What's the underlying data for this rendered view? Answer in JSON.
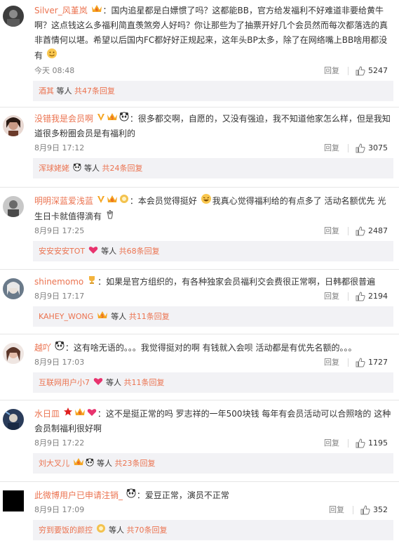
{
  "comments": [
    {
      "username": "Silver_风堇岚",
      "text": "：国内追星都是白嫖惯了吗？这都能BB，官方给发福利不好难道非要给黄牛啊？这点钱这么多福利简直羡煞旁人好吗？你让那些为了抽票开好几个会员然而每次都落选的真非酋情何以堪。希望以后国内FC都好好正规起来，这年头BP太多，除了在网络嘴上BB啥用都没有",
      "time": "今天 08:48",
      "reply_label": "回复",
      "likes": "5247",
      "reply_user": "酒其",
      "reply_mid": " 等人 ",
      "reply_count": "共47条回复"
    },
    {
      "username": "没错我是会员啊",
      "text": "：很多都交啊，自愿的，又没有强迫，我不知道他家怎么样，但是我知道很多粉圈会员是有福利的",
      "time": "8月9日 17:12",
      "reply_label": "回复",
      "likes": "3075",
      "reply_user": "浑球姥姥",
      "reply_mid": " 等人 ",
      "reply_count": "共24条回复"
    },
    {
      "username": "明明深蓝爱浅蓝",
      "text": "：本会员觉得挺好",
      "text2": "我真心觉得福利给的有点多了 活动名额优先 光生日卡就值得滴有",
      "time": "8月9日 17:25",
      "reply_label": "回复",
      "likes": "2487",
      "reply_user": "安安安安TOT",
      "reply_mid": " 等人 ",
      "reply_count": "共68条回复"
    },
    {
      "username": "shinemomo",
      "text": "：如果是官方组织的，有各种独家会员福利交会费很正常啊，日韩都很普遍",
      "time": "8月9日 17:17",
      "reply_label": "回复",
      "likes": "2194",
      "reply_user": "KAHEY_WONG",
      "reply_mid": " 等人 ",
      "reply_count": "共11条回复"
    },
    {
      "username": "越吖",
      "text": "：这有啥无语的。。。我觉得挺对的啊 有钱就入会呗 活动都是有优先名额的。。。",
      "time": "8月9日 17:03",
      "reply_label": "回复",
      "likes": "1727",
      "reply_user": "互联网用户小7",
      "reply_mid": " 等人 ",
      "reply_count": "共11条回复"
    },
    {
      "username": "水日皿",
      "text": "：这不是挺正常的吗 罗志祥的一年500块钱 每年有会员活动可以合照啥的 这种会员制福利很好啊",
      "time": "8月9日 17:22",
      "reply_label": "回复",
      "likes": "1195",
      "reply_user": "刘大叉儿",
      "reply_mid": " 等人 ",
      "reply_count": "共23条回复"
    },
    {
      "username": "此微博用户已申请注销_",
      "text": "：爱豆正常，演员不正常",
      "time": "8月9日 17:09",
      "reply_label": "回复",
      "likes": "352",
      "reply_user": "穷到要饭的颜控",
      "reply_mid": " 等人 ",
      "reply_count": "共70条回复"
    }
  ],
  "colors": {
    "accent": "#eb7350",
    "reply_bg": "#f2f2f5",
    "meta": "#808080"
  }
}
